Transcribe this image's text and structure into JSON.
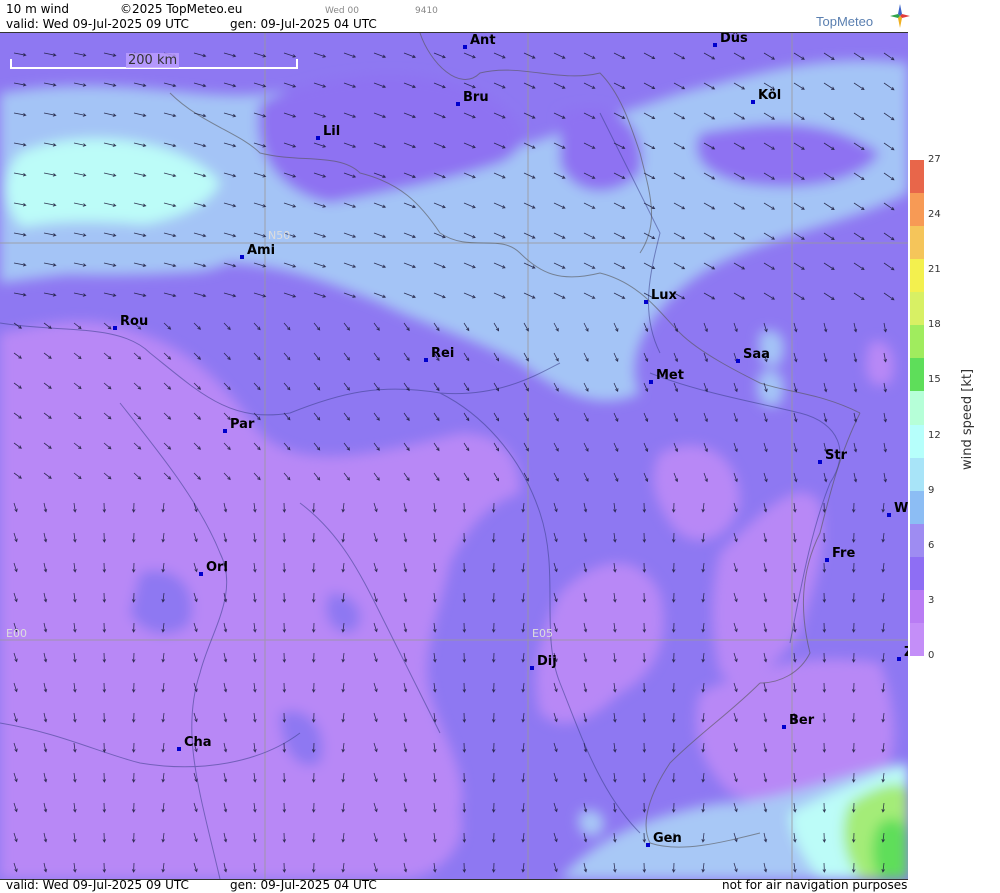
{
  "header": {
    "line1_left": "10 m wind",
    "copyright": "©2025 TopMeteo.eu",
    "line1_mid": "Wed 00",
    "line1_code": "9410",
    "valid": "valid:  Wed  09-Jul-2025  09 UTC",
    "gen": "gen: 09-Jul-2025 04 UTC"
  },
  "logo": {
    "text": "TopMeteo",
    "icon": "compass-star-icon"
  },
  "scale_bar": {
    "label": "200 km"
  },
  "grid_labels": {
    "n50": "N50",
    "e00": "E00",
    "e05": "E05"
  },
  "cities": [
    {
      "id": "ant",
      "label": "Ant"
    },
    {
      "id": "dus",
      "label": "Düs"
    },
    {
      "id": "bru",
      "label": "Bru"
    },
    {
      "id": "kol",
      "label": "Köl"
    },
    {
      "id": "lil",
      "label": "Lil"
    },
    {
      "id": "ami",
      "label": "Ami"
    },
    {
      "id": "lux",
      "label": "Lux"
    },
    {
      "id": "rou",
      "label": "Rou"
    },
    {
      "id": "rei",
      "label": "Rei"
    },
    {
      "id": "saa",
      "label": "Saa"
    },
    {
      "id": "met",
      "label": "Met"
    },
    {
      "id": "par",
      "label": "Par"
    },
    {
      "id": "str",
      "label": "Str"
    },
    {
      "id": "w",
      "label": "W"
    },
    {
      "id": "fre",
      "label": "Fre"
    },
    {
      "id": "orl",
      "label": "Orl"
    },
    {
      "id": "dij",
      "label": "Dij"
    },
    {
      "id": "z",
      "label": "Z"
    },
    {
      "id": "ber",
      "label": "Ber"
    },
    {
      "id": "cha",
      "label": "Cha"
    },
    {
      "id": "gen",
      "label": "Gen"
    }
  ],
  "legend": {
    "title": "wind  speed  [kt]",
    "ticks": [
      "27",
      "24",
      "21",
      "18",
      "15",
      "12",
      "9",
      "6",
      "3",
      "0"
    ],
    "colors": [
      "#e8664a",
      "#f79a55",
      "#f5c55a",
      "#f3f04e",
      "#d8f064",
      "#a0ec5e",
      "#5ede5a",
      "#b6ffd8",
      "#b6fffb",
      "#a8e4f8",
      "#8cbdf4",
      "#9e8cf2",
      "#8e6ef4",
      "#b97cf4",
      "#c48ef8"
    ]
  },
  "footer": {
    "valid": "valid:  Wed  09-Jul-2025  09 UTC",
    "gen": "gen: 09-Jul-2025 04 UTC",
    "disclaimer": "not for air navigation purposes"
  }
}
